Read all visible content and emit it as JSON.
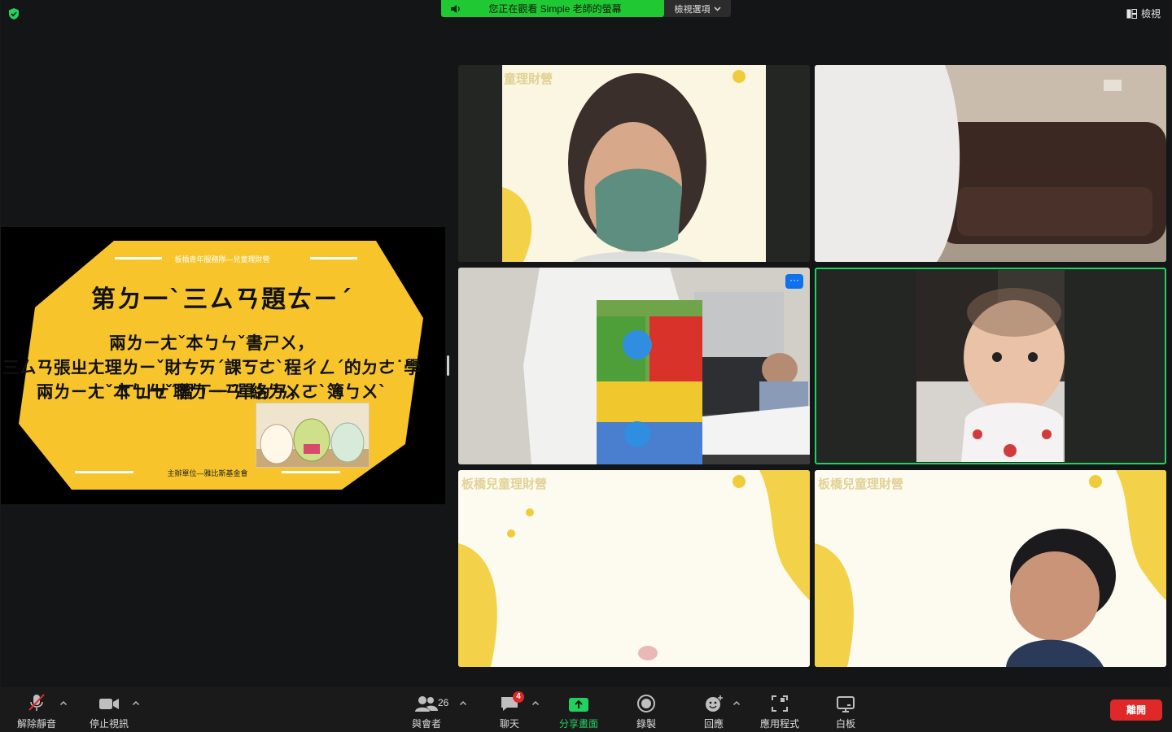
{
  "top_bar": {
    "banner_text": "您正在觀看 Simple 老師的螢幕",
    "view_options_label": "檢視選項",
    "view_label": "檢視"
  },
  "slide": {
    "header": "板橋青年服務隊—兒童理財營",
    "title": "第ㄉ一ˋ三ㄙㄢ題ㄊㄧˊ",
    "line1": "兩ㄌㄧㄤˇ本ㄅㄣˇ書ㄕㄨ，",
    "line2": "三ㄙㄢ張ㄓㄤ理ㄌㄧˇ財ㄘㄞˊ課ㄎㄜˋ程ㄔㄥˊ的ㄉㄜ˙學ㄒㄩㄝˊ習ㄒㄧˊ單ㄉㄢ，",
    "line3": "兩ㄌㄧㄤˇ本ㄅㄣˇ聯ㄌㄧㄢˊ絡ㄌㄨㄛˋ簿ㄅㄨˋ",
    "footer": "主辦單位—雅比斯基金會",
    "colors": {
      "background": "#f7c52b",
      "text": "#111111"
    }
  },
  "tiles": [
    {
      "watermark": "童理財營"
    },
    {
      "watermark": ""
    },
    {
      "watermark": ""
    },
    {
      "watermark": ""
    },
    {
      "watermark": "板橋兒童理財營"
    },
    {
      "watermark": "板橋兒童理財營"
    }
  ],
  "toolbar": {
    "unmute": "解除靜音",
    "stop_video": "停止視訊",
    "participants": "與會者",
    "participants_count": "26",
    "chat": "聊天",
    "chat_badge": "4",
    "share": "分享畫面",
    "record": "錄製",
    "reactions": "回應",
    "apps": "應用程式",
    "whiteboard": "白板",
    "leave": "離開"
  },
  "colors": {
    "accent_green": "#23d160",
    "leave_red": "#e02828",
    "share_blue": "#0e72ed"
  }
}
